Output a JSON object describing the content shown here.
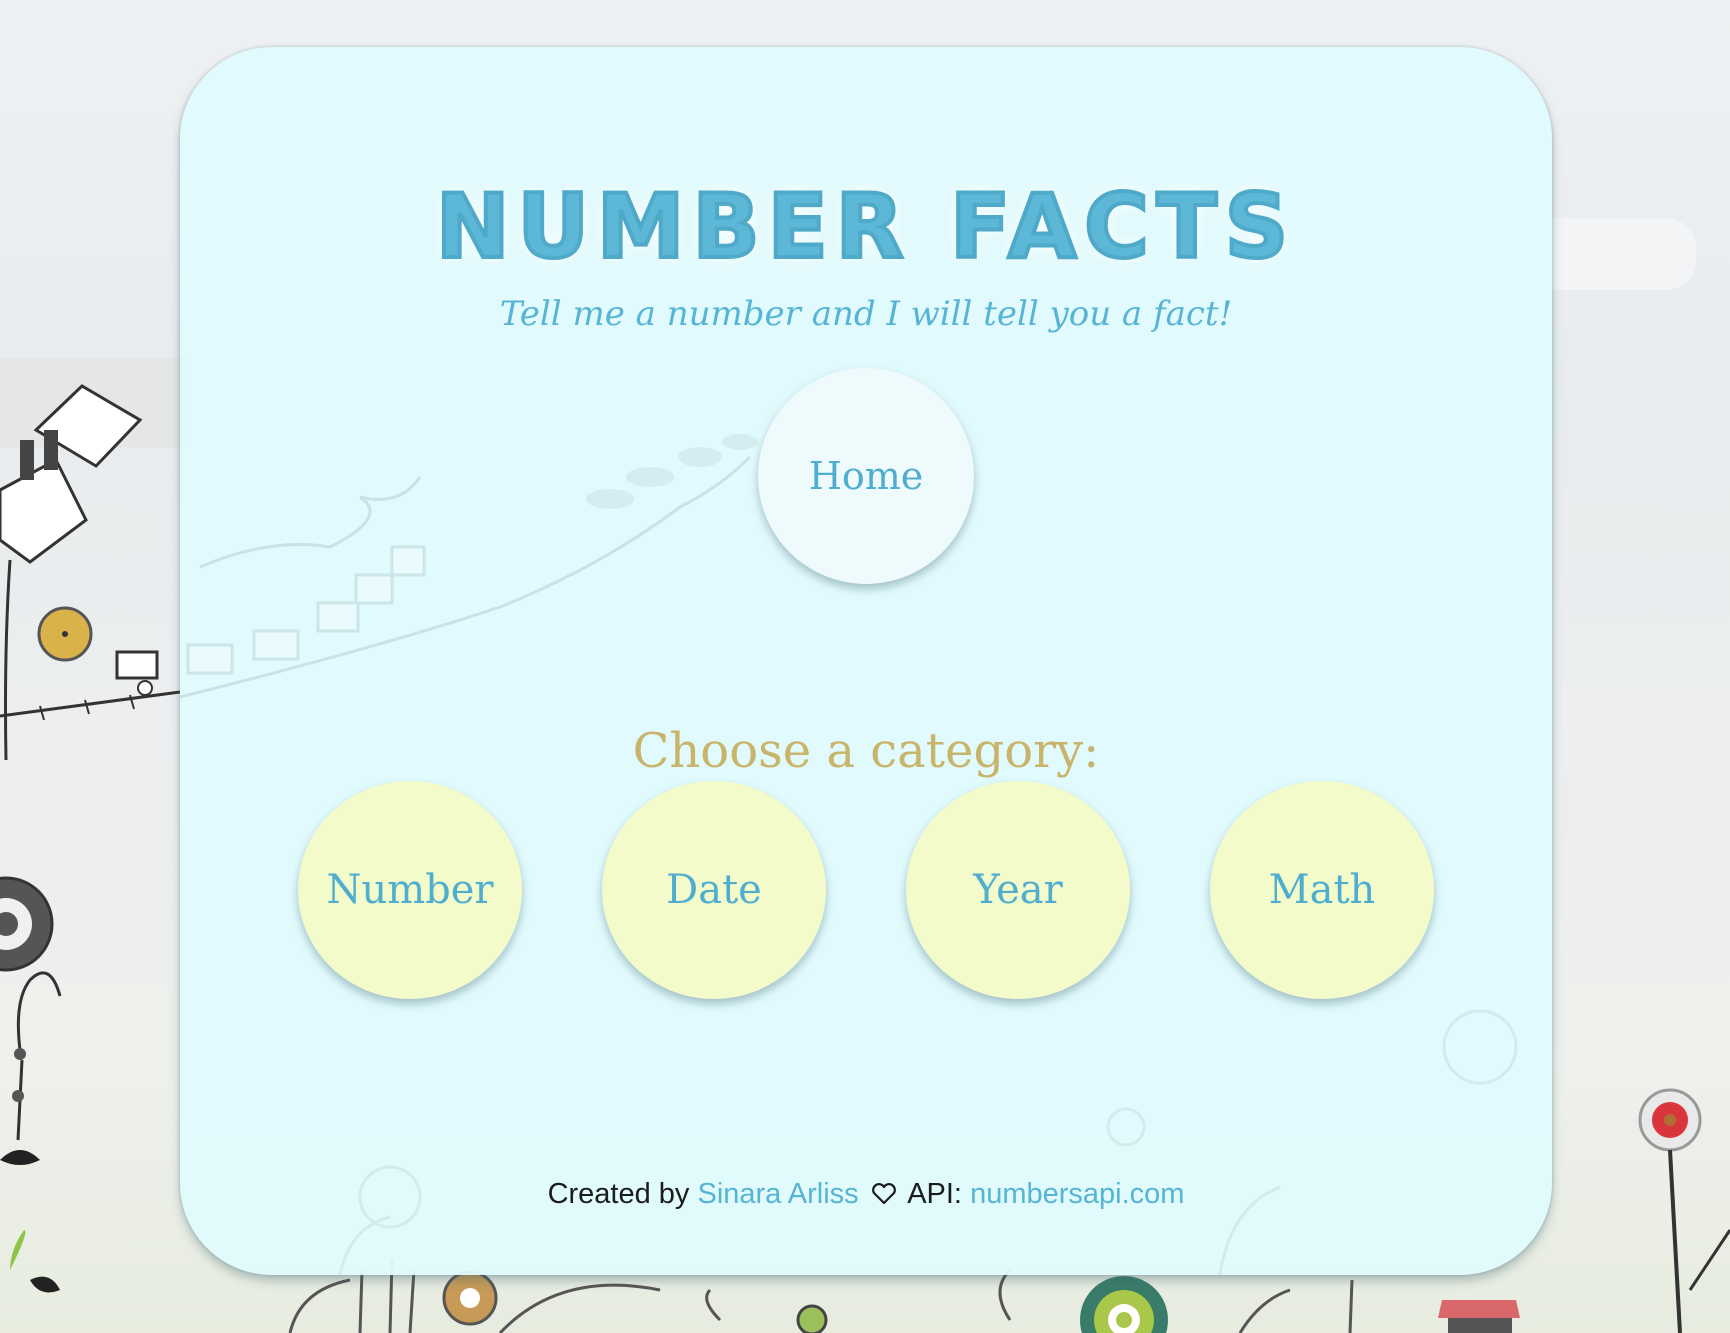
{
  "header": {
    "title": "NUMBER FACTS",
    "subtitle": "Tell me a number and I will tell you a fact!"
  },
  "nav": {
    "home_label": "Home"
  },
  "categories": {
    "heading": "Choose a category:",
    "items": [
      {
        "label": "Number"
      },
      {
        "label": "Date"
      },
      {
        "label": "Year"
      },
      {
        "label": "Math"
      }
    ]
  },
  "footer": {
    "created_by_text": "Created by",
    "author_link": "Sinara Arliss",
    "heart_icon": "heart-outline-icon",
    "api_text": "API:",
    "api_link": "numbersapi.com"
  },
  "colors": {
    "title": "#5cb8d6",
    "category_heading": "#c8b46a",
    "category_button_bg": "#f3fbcb",
    "card_bg": "#e0fafd",
    "link": "#56b4d4"
  }
}
